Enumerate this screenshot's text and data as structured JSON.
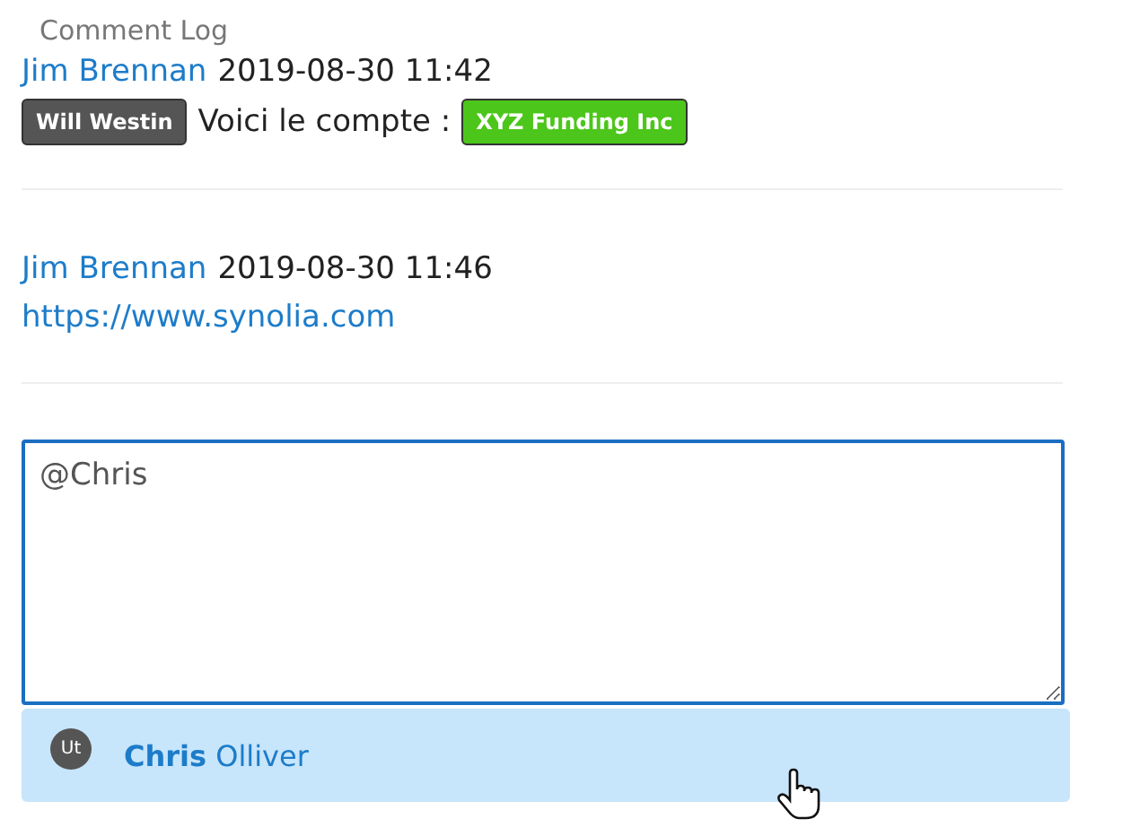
{
  "section_title": "Comment Log",
  "comments": [
    {
      "author": "Jim Brennan",
      "time": "2019-08-30 11:42",
      "body": [
        {
          "kind": "tag",
          "text": "Will Westin",
          "color": "#555555"
        },
        {
          "kind": "text",
          "text": "Voici le compte :"
        },
        {
          "kind": "tag",
          "text": "XYZ Funding Inc",
          "color": "#4cc61a"
        }
      ]
    },
    {
      "author": "Jim Brennan",
      "time": "2019-08-30 11:46",
      "body": [
        {
          "kind": "link",
          "text": "https://www.synolia.com"
        }
      ]
    }
  ],
  "comment_input": {
    "value": "@Chris"
  },
  "suggestions": [
    {
      "initials": "Ut",
      "name": "**Chris** Olliver",
      "selected": true
    }
  ]
}
